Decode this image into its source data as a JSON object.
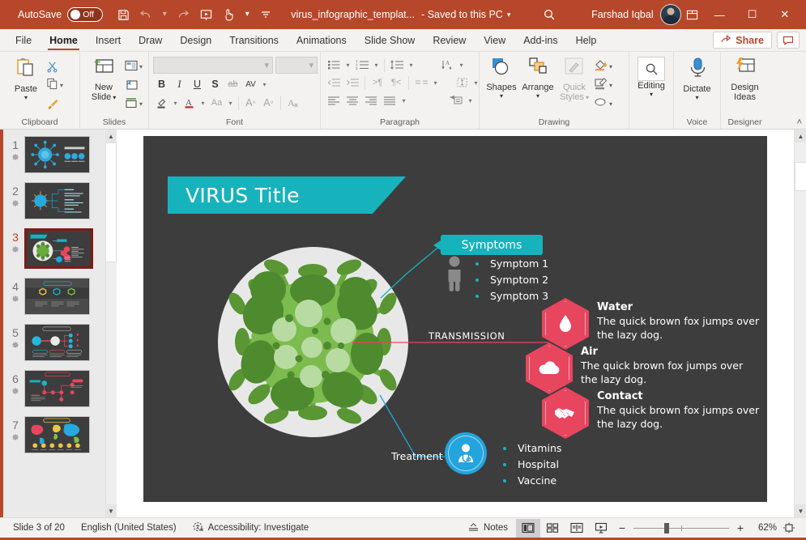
{
  "titlebar": {
    "autosave_label": "AutoSave",
    "autosave_state": "Off",
    "save_icon": "save-icon",
    "undo_icon": "undo-icon",
    "redo_icon": "redo-icon",
    "present_icon": "start-presentation-icon",
    "touch_icon": "touch-mode-icon",
    "customize_icon": "customize-quick-access-icon",
    "document_title": "virus_infographic_templat...",
    "saved_state": "-  Saved to this PC",
    "search_icon": "search-icon",
    "user_name": "Farshad Iqbal",
    "avatar": "user-avatar",
    "ribbon_display_icon": "ribbon-display-options-icon",
    "minimize": "—",
    "maximize": "☐",
    "close": "✕"
  },
  "tabs": [
    {
      "label": "File",
      "active": false
    },
    {
      "label": "Home",
      "active": true
    },
    {
      "label": "Insert",
      "active": false
    },
    {
      "label": "Draw",
      "active": false
    },
    {
      "label": "Design",
      "active": false
    },
    {
      "label": "Transitions",
      "active": false
    },
    {
      "label": "Animations",
      "active": false
    },
    {
      "label": "Slide Show",
      "active": false
    },
    {
      "label": "Review",
      "active": false
    },
    {
      "label": "View",
      "active": false
    },
    {
      "label": "Add-ins",
      "active": false
    },
    {
      "label": "Help",
      "active": false
    }
  ],
  "tabs_right": {
    "share_label": "Share",
    "share_icon": "share-icon",
    "comment_icon": "comments-icon"
  },
  "ribbon": {
    "groups": [
      {
        "name": "Clipboard",
        "title": "Clipboard"
      },
      {
        "name": "Slides",
        "title": "Slides"
      },
      {
        "name": "Font",
        "title": "Font"
      },
      {
        "name": "Paragraph",
        "title": "Paragraph"
      },
      {
        "name": "Drawing",
        "title": "Drawing"
      },
      {
        "name": "Voice",
        "title": "Voice"
      },
      {
        "name": "Designer",
        "title": "Designer"
      }
    ],
    "clipboard": {
      "paste_label": "Paste",
      "paste_icon": "paste-icon",
      "cut_icon": "cut-scissors-icon",
      "copy_icon": "copy-icon",
      "format_painter_icon": "format-painter-icon"
    },
    "slides": {
      "new_slide_label": "New\nSlide",
      "new_slide_label_l1": "New",
      "new_slide_label_l2": "Slide",
      "new_slide_icon": "new-slide-icon",
      "layout_icon": "slide-layout-icon",
      "reset_icon": "reset-slide-icon",
      "section_icon": "section-icon"
    },
    "font": {
      "font_name_value": "",
      "font_size_value": "",
      "bold": "B",
      "italic": "I",
      "underline": "U",
      "shadow": "S",
      "strikethrough": "ab",
      "spacing": "AV",
      "highlight_icon": "text-highlight-icon",
      "fontcolor_icon": "font-color-icon",
      "changecase": "Aa",
      "increase_size": "A",
      "decrease_size": "A",
      "clear_format_icon": "clear-formatting-icon"
    },
    "paragraph": {
      "bullets_icon": "bullets-icon",
      "numbering_icon": "numbering-icon",
      "line_spacing_icon": "line-spacing-icon",
      "text_direction_icon": "text-direction-icon",
      "decrease_indent_icon": "decrease-indent-icon",
      "increase_indent_icon": "increase-indent-icon",
      "ltr_icon": "left-to-right-icon",
      "rtl_icon": "right-to-left-icon",
      "columns_icon": "columns-icon",
      "align_text_icon": "align-text-icon",
      "align_left_icon": "align-left-icon",
      "align_center_icon": "align-center-icon",
      "align_right_icon": "align-right-icon",
      "justify_icon": "justify-icon",
      "smartart_icon": "convert-to-smartart-icon"
    },
    "drawing": {
      "shapes_label": "Shapes",
      "shapes_icon": "shapes-icon",
      "arrange_label": "Arrange",
      "arrange_icon": "arrange-icon",
      "quick_styles_l1": "Quick",
      "quick_styles_l2": "Styles",
      "quick_styles_icon": "quick-styles-icon",
      "shape_fill_icon": "shape-fill-icon",
      "shape_outline_icon": "shape-outline-icon",
      "shape_effects_icon": "shape-effects-icon"
    },
    "editing": {
      "label": "Editing",
      "icon": "find-magnifier-icon"
    },
    "voice": {
      "dictate_label": "Dictate",
      "dictate_icon": "microphone-icon"
    },
    "designer": {
      "design_ideas_l1": "Design",
      "design_ideas_l2": "Ideas",
      "design_ideas_icon": "design-ideas-icon"
    },
    "collapse_icon": "collapse-ribbon-icon"
  },
  "thumbnails": {
    "scroll_up_icon": "scroll-up-icon",
    "scroll_down_icon": "scroll-down-icon",
    "items": [
      {
        "number": "1",
        "star": "✵",
        "selected": false
      },
      {
        "number": "2",
        "star": "✵",
        "selected": false
      },
      {
        "number": "3",
        "star": "✵",
        "selected": true
      },
      {
        "number": "4",
        "star": "✵",
        "selected": false
      },
      {
        "number": "5",
        "star": "✵",
        "selected": false
      },
      {
        "number": "6",
        "star": "✵",
        "selected": false
      },
      {
        "number": "7",
        "star": "✵",
        "selected": false
      }
    ]
  },
  "slide": {
    "title": "VIRUS Title",
    "symptoms": {
      "header": "Symptoms",
      "items": [
        "Symptom 1",
        "Symptom 2",
        "Symptom 3"
      ],
      "icon": "person-icon"
    },
    "transmission": {
      "label": "TRANSMISSION",
      "items": [
        {
          "heading": "Water",
          "body_line1": "The quick brown fox jumps over",
          "body_line2": "the lazy dog.",
          "icon": "water-drop-icon"
        },
        {
          "heading": "Air",
          "body_line1": "The quick brown fox jumps over",
          "body_line2": "the lazy dog.",
          "icon": "cloud-icon"
        },
        {
          "heading": "Contact",
          "body_line1": "The quick brown fox jumps over",
          "body_line2": "the lazy dog.",
          "icon": "handshake-icon"
        }
      ]
    },
    "treatment": {
      "label": "Treatment",
      "icon": "doctor-icon",
      "items": [
        "Vitamins",
        "Hospital",
        "Vaccine"
      ]
    },
    "virus_graphic": "virus-cell-illustration",
    "colors": {
      "background": "#3d3d3d",
      "teal": "#17b3bd",
      "red": "#e8455f",
      "blue": "#23a4dd",
      "green": "#6aaa3f"
    }
  },
  "statusbar": {
    "slide_count": "Slide 3 of 20",
    "language": "English (United States)",
    "accessibility": "Accessibility: Investigate",
    "accessibility_icon": "accessibility-icon",
    "notes_label": "Notes",
    "notes_icon": "notes-icon",
    "view_normal_icon": "normal-view-icon",
    "view_sorter_icon": "slide-sorter-icon",
    "view_reading_icon": "reading-view-icon",
    "view_slideshow_icon": "slideshow-view-icon",
    "zoom_out": "−",
    "zoom_in": "+",
    "zoom_value": "62%",
    "fit_icon": "fit-slide-to-window-icon"
  }
}
